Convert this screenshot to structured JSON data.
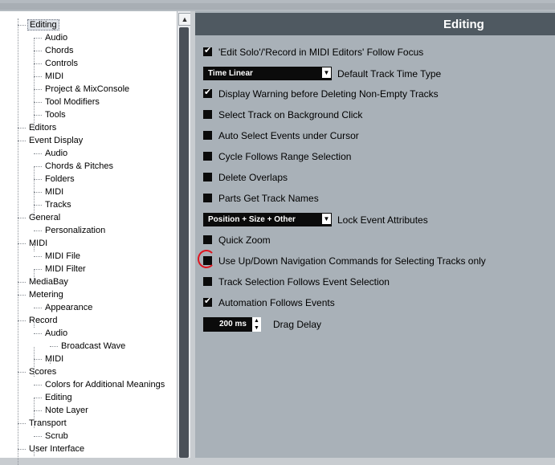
{
  "tree": {
    "items": [
      {
        "label": "Editing",
        "level": 0,
        "selected": true
      },
      {
        "label": "Audio",
        "level": 1
      },
      {
        "label": "Chords",
        "level": 1
      },
      {
        "label": "Controls",
        "level": 1
      },
      {
        "label": "MIDI",
        "level": 1
      },
      {
        "label": "Project & MixConsole",
        "level": 1
      },
      {
        "label": "Tool Modifiers",
        "level": 1
      },
      {
        "label": "Tools",
        "level": 1
      },
      {
        "label": "Editors",
        "level": 0
      },
      {
        "label": "Event Display",
        "level": 0
      },
      {
        "label": "Audio",
        "level": 1
      },
      {
        "label": "Chords & Pitches",
        "level": 1
      },
      {
        "label": "Folders",
        "level": 1
      },
      {
        "label": "MIDI",
        "level": 1
      },
      {
        "label": "Tracks",
        "level": 1
      },
      {
        "label": "General",
        "level": 0
      },
      {
        "label": "Personalization",
        "level": 1
      },
      {
        "label": "MIDI",
        "level": 0
      },
      {
        "label": "MIDI File",
        "level": 1
      },
      {
        "label": "MIDI Filter",
        "level": 1
      },
      {
        "label": "MediaBay",
        "level": 0
      },
      {
        "label": "Metering",
        "level": 0
      },
      {
        "label": "Appearance",
        "level": 1
      },
      {
        "label": "Record",
        "level": 0
      },
      {
        "label": "Audio",
        "level": 1
      },
      {
        "label": "Broadcast Wave",
        "level": 2
      },
      {
        "label": "MIDI",
        "level": 1
      },
      {
        "label": "Scores",
        "level": 0
      },
      {
        "label": "Colors for Additional Meanings",
        "level": 1
      },
      {
        "label": "Editing",
        "level": 1
      },
      {
        "label": "Note Layer",
        "level": 1
      },
      {
        "label": "Transport",
        "level": 0
      },
      {
        "label": "Scrub",
        "level": 1
      },
      {
        "label": "User Interface",
        "level": 0
      }
    ]
  },
  "panel": {
    "title": "Editing",
    "options": [
      {
        "type": "check",
        "label": "'Edit Solo'/'Record in MIDI Editors' Follow Focus",
        "checked": true
      },
      {
        "type": "select",
        "value": "Time Linear",
        "label": "Default Track Time Type"
      },
      {
        "type": "check",
        "label": "Display Warning before Deleting Non-Empty Tracks",
        "checked": true
      },
      {
        "type": "check",
        "label": "Select Track on Background Click",
        "checked": false
      },
      {
        "type": "check",
        "label": "Auto Select Events under Cursor",
        "checked": false
      },
      {
        "type": "check",
        "label": "Cycle Follows Range Selection",
        "checked": false
      },
      {
        "type": "check",
        "label": "Delete Overlaps",
        "checked": false
      },
      {
        "type": "check",
        "label": "Parts Get Track Names",
        "checked": false
      },
      {
        "type": "select",
        "value": "Position + Size + Other",
        "label": "Lock Event Attributes"
      },
      {
        "type": "check",
        "label": "Quick Zoom",
        "checked": false
      },
      {
        "type": "check",
        "label": "Use Up/Down Navigation Commands for Selecting Tracks only",
        "checked": false,
        "annotated": true
      },
      {
        "type": "check",
        "label": "Track Selection Follows Event Selection",
        "checked": false
      },
      {
        "type": "check",
        "label": "Automation Follows Events",
        "checked": true
      },
      {
        "type": "spin",
        "value": "200 ms",
        "label": "Drag Delay"
      }
    ]
  },
  "colors": {
    "panel_bg": "#a9b1b8",
    "header_bg": "#4f5961",
    "annotation": "#e0141e"
  }
}
